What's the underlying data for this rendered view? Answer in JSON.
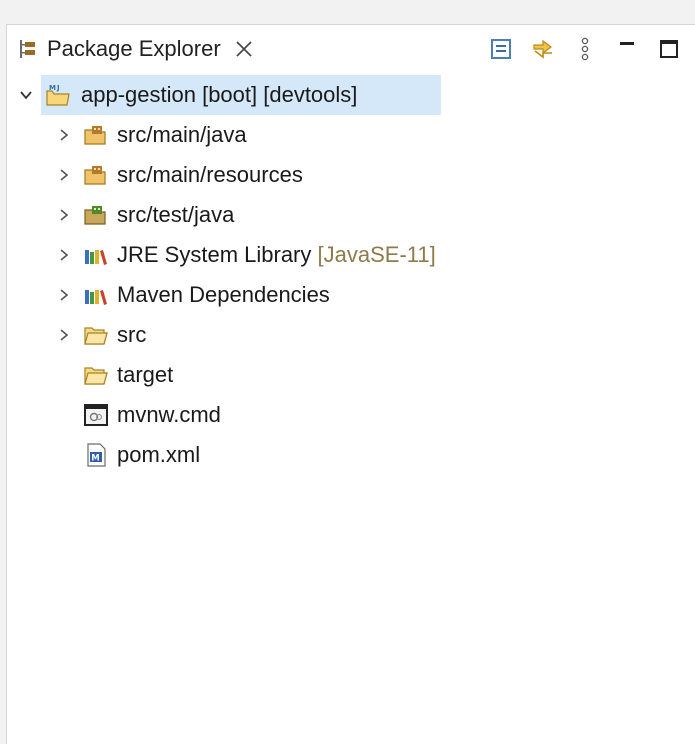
{
  "tab": {
    "title": "Package Explorer",
    "icon": "package-explorer-icon",
    "close_icon": "close-icon"
  },
  "toolbar": {
    "items": [
      {
        "name": "collapse-all-icon"
      },
      {
        "name": "link-with-editor-icon"
      },
      {
        "name": "view-menu-icon"
      },
      {
        "name": "minimize-icon"
      },
      {
        "name": "maximize-icon"
      }
    ]
  },
  "tree": {
    "root": {
      "label": "app-gestion [boot] [devtools]",
      "expanded": true,
      "selected": true,
      "icon": "maven-project-icon"
    },
    "children": [
      {
        "label": "src/main/java",
        "suffix": "",
        "expandable": true,
        "icon": "source-folder-icon"
      },
      {
        "label": "src/main/resources",
        "suffix": "",
        "expandable": true,
        "icon": "source-folder-icon"
      },
      {
        "label": "src/test/java",
        "suffix": "",
        "expandable": true,
        "icon": "test-source-folder-icon"
      },
      {
        "label": "JRE System Library",
        "suffix": "[JavaSE-11]",
        "expandable": true,
        "icon": "library-icon"
      },
      {
        "label": "Maven Dependencies",
        "suffix": "",
        "expandable": true,
        "icon": "library-icon"
      },
      {
        "label": "src",
        "suffix": "",
        "expandable": true,
        "icon": "folder-icon"
      },
      {
        "label": "target",
        "suffix": "",
        "expandable": false,
        "icon": "folder-icon"
      },
      {
        "label": "mvnw.cmd",
        "suffix": "",
        "expandable": false,
        "icon": "cmd-file-icon"
      },
      {
        "label": "pom.xml",
        "suffix": "",
        "expandable": false,
        "icon": "maven-pom-icon"
      }
    ]
  },
  "colors": {
    "selection": "#d5e8f9",
    "decoration_text": "#8e7a4a",
    "folder": "#e7b54a"
  }
}
